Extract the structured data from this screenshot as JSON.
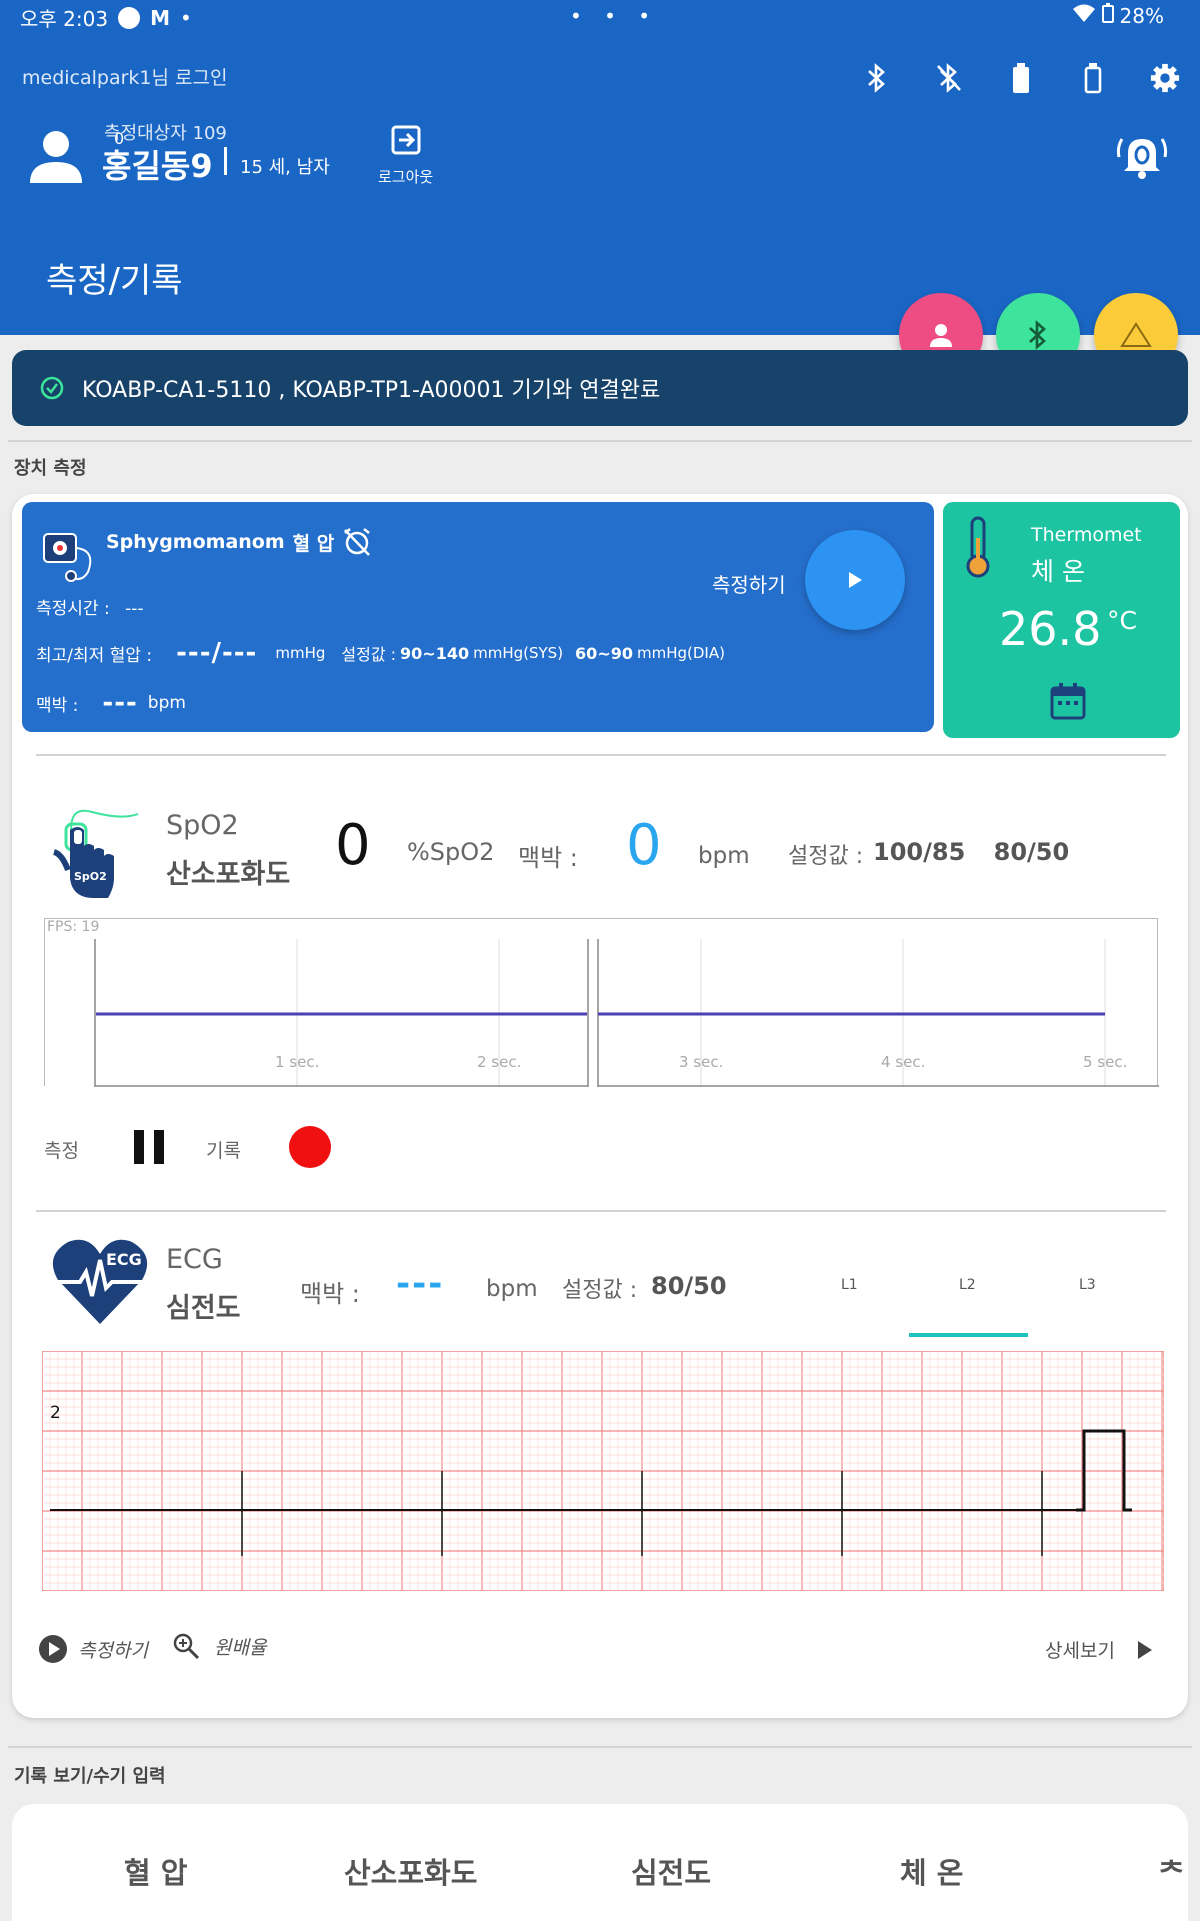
{
  "status_bar": {
    "time": "오후 2:03",
    "battery": "28%",
    "dots": "• • •"
  },
  "header": {
    "login_text": "medicalpark1님 로그인",
    "subject_label": "측정대상자 109",
    "name": "홍길동9",
    "age_gender": "15 세, 남자",
    "logout_label": "로그아웃",
    "alarm_count": "0",
    "page_title": "측정/기록"
  },
  "banner": {
    "text": "KOABP-CA1-5110 , KOABP-TP1-A00001 기기와 연결완료"
  },
  "sections": {
    "device": "장치 측정",
    "records": "기록 보기/수기 입력"
  },
  "blood_pressure": {
    "device_name": "Sphygmomanom",
    "title": "혈 압",
    "time_label": "측정시간 :",
    "time_value": "---",
    "bp_label": "최고/최저 혈압 :",
    "bp_value": "---/---",
    "bp_unit": "mmHg",
    "setting_label": "설정값 :",
    "sys_value": "90~140",
    "sys_unit": "mmHg(SYS)",
    "dia_value": "60~90",
    "dia_unit": "mmHg(DIA)",
    "pulse_label": "맥박 :",
    "pulse_value": "---",
    "pulse_unit": "bpm",
    "measure_label": "측정하기"
  },
  "thermometer": {
    "device_name": "Thermomet",
    "title": "체 온",
    "value": "26.8",
    "unit": "°C"
  },
  "spo2": {
    "name": "SpO2",
    "title": "산소포화도",
    "icon_label": "SpO2",
    "spo2_value": "0",
    "spo2_unit": "%SpO2",
    "pulse_label": "맥박 :",
    "pulse_value": "0",
    "pulse_unit": "bpm",
    "setting_label": "설정값 :",
    "setting_value_1": "100/85",
    "setting_value_2": "80/50",
    "fps": "FPS: 19",
    "ticks": [
      "1 sec.",
      "2 sec.",
      "3 sec.",
      "4 sec.",
      "5 sec."
    ],
    "measure_label": "측정",
    "record_label": "기록"
  },
  "ecg": {
    "name": "ECG",
    "title": "심전도",
    "icon_label": "ECG",
    "pulse_label": "맥박 :",
    "pulse_value": "---",
    "pulse_unit": "bpm",
    "setting_label": "설정값 :",
    "setting_value": "80/50",
    "leads": [
      "L1",
      "L2",
      "L3"
    ],
    "selected_lead": "L2",
    "scale_label": "2",
    "measure_label": "측정하기",
    "zoom_label": "원배율",
    "detail_label": "상세보기"
  },
  "record_tabs": [
    "혈 압",
    "산소포화도",
    "심전도",
    "체 온",
    "ᄎ"
  ],
  "colors": {
    "primary": "#1a66c5",
    "banner": "#17426a",
    "thermo": "#1cc4a1",
    "accent_blue": "#2aa6ef",
    "fab_pink": "#ee4d84",
    "fab_green": "#3ee49b",
    "fab_yellow": "#fbcb3a"
  }
}
